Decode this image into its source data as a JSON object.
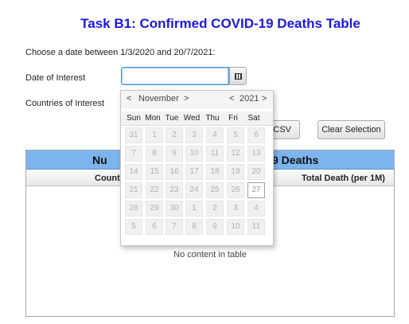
{
  "title": "Task B1: Confirmed COVID-19 Deaths Table",
  "instruction": "Choose a date between 1/3/2020 and 20/7/2021:",
  "date_label": "Date of Interest",
  "date_value": "",
  "calendar_icon": "calendar-icon",
  "countries_label": "Countries of Interest",
  "buttons": {
    "export_csv": "s CSV",
    "clear": "Clear Selection"
  },
  "table": {
    "title_left": "Nu",
    "title_right": "9 Deaths",
    "col_country": "Country",
    "col_total": "Total Death (per 1M)",
    "empty_text": "No content in table"
  },
  "calendar": {
    "month_prev": "<",
    "month": "November",
    "month_next": ">",
    "year_prev": "<",
    "year": "2021",
    "year_next": ">",
    "weekdays": [
      "Sun",
      "Mon",
      "Tue",
      "Wed",
      "Thu",
      "Fri",
      "Sat"
    ],
    "weeks": [
      [
        "31",
        "1",
        "2",
        "3",
        "4",
        "5",
        "6"
      ],
      [
        "7",
        "8",
        "9",
        "10",
        "11",
        "12",
        "13"
      ],
      [
        "14",
        "15",
        "16",
        "17",
        "18",
        "19",
        "20"
      ],
      [
        "21",
        "22",
        "23",
        "24",
        "25",
        "26",
        "27"
      ],
      [
        "28",
        "29",
        "30",
        "1",
        "2",
        "3",
        "4"
      ],
      [
        "5",
        "6",
        "7",
        "8",
        "9",
        "10",
        "11"
      ]
    ],
    "highlighted_day": "27"
  }
}
